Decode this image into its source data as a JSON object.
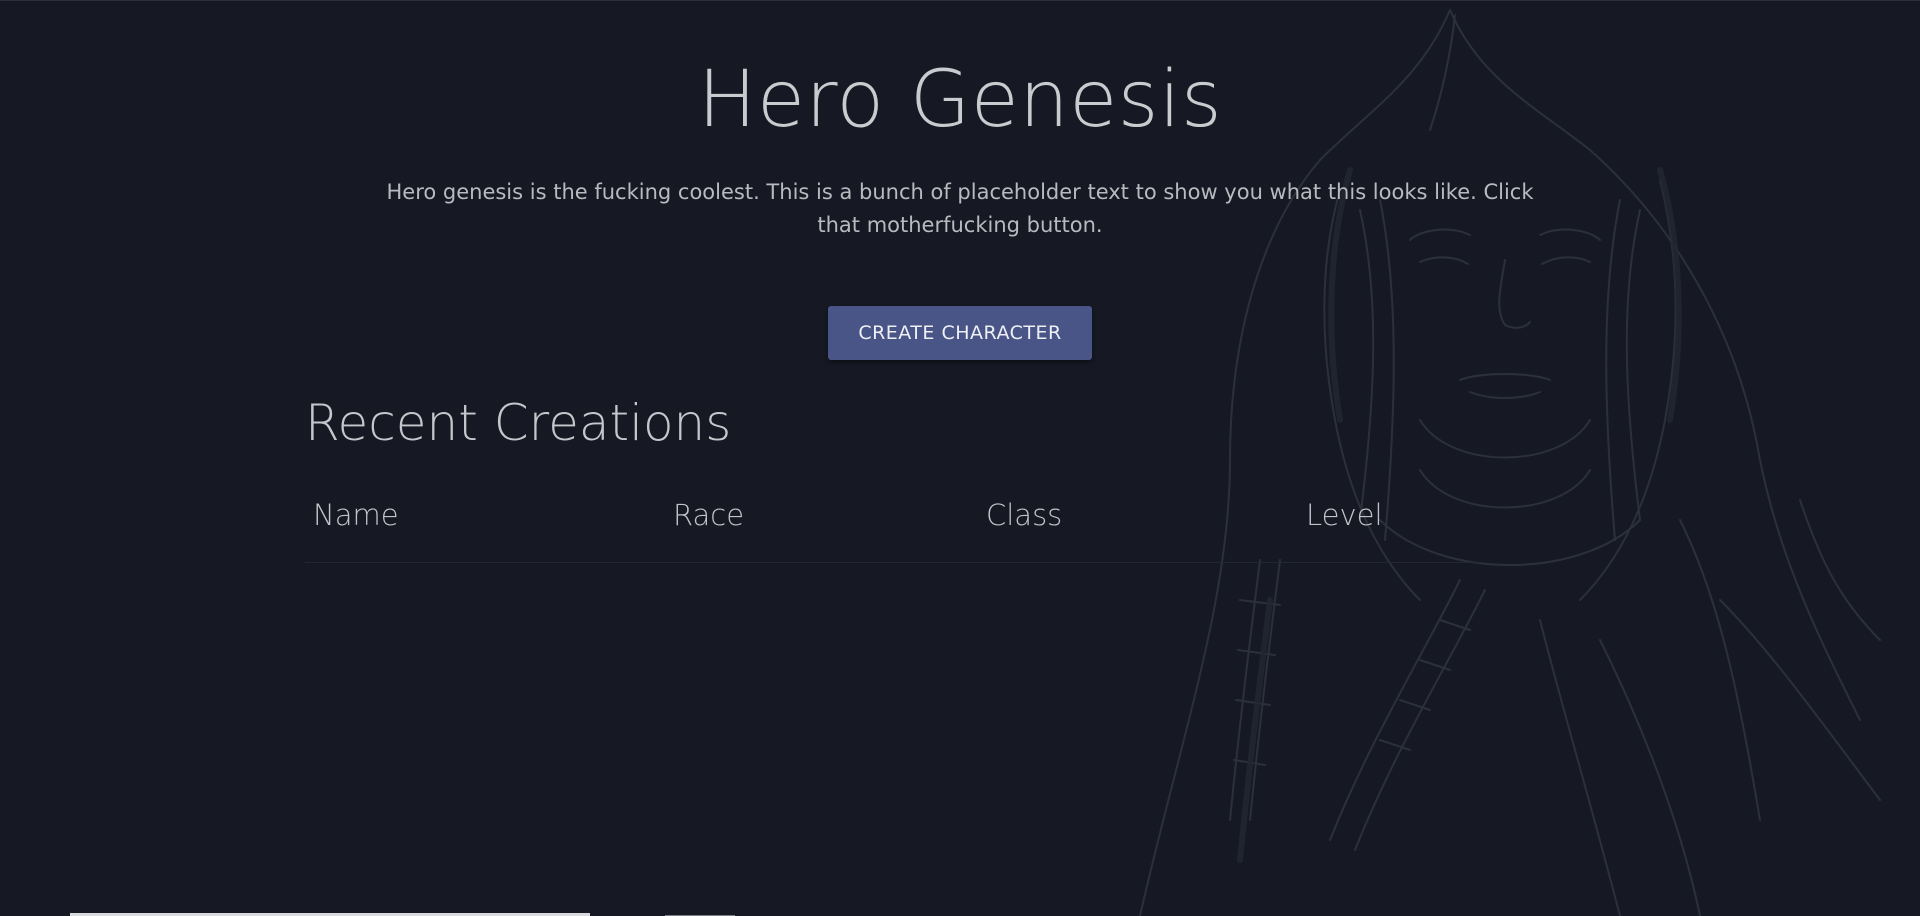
{
  "hero": {
    "title": "Hero Genesis",
    "description": "Hero genesis is the fucking coolest. This is a bunch of placeholder text to show you what this looks like. Click that motherfucking button.",
    "button_label": "CREATE CHARACTER"
  },
  "recent": {
    "title": "Recent Creations",
    "columns": [
      "Name",
      "Race",
      "Class",
      "Level"
    ],
    "rows": []
  },
  "colors": {
    "background": "#161923",
    "button": "#495587",
    "text": "#c5c7cc"
  },
  "icons": {
    "background_art": "hooded-figure-sketch"
  }
}
